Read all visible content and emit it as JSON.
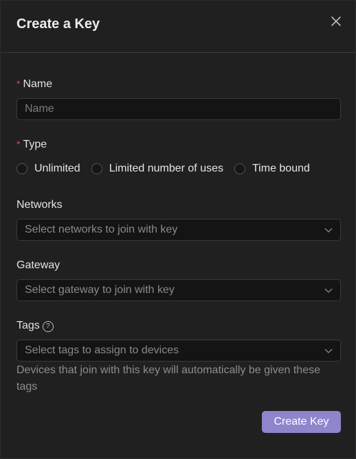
{
  "modal": {
    "title": "Create a Key"
  },
  "form": {
    "name": {
      "label": "Name",
      "required_mark": "*",
      "placeholder": "Name",
      "value": ""
    },
    "type": {
      "label": "Type",
      "required_mark": "*",
      "options": [
        {
          "label": "Unlimited",
          "selected": false
        },
        {
          "label": "Limited number of uses",
          "selected": false
        },
        {
          "label": "Time bound",
          "selected": false
        }
      ]
    },
    "networks": {
      "label": "Networks",
      "placeholder": "Select networks to join with key"
    },
    "gateway": {
      "label": "Gateway",
      "placeholder": "Select gateway to join with key"
    },
    "tags": {
      "label": "Tags",
      "help_icon": "question-circle-icon",
      "placeholder": "Select tags to assign to devices",
      "hint": "Devices that join with this key will automatically be given these tags"
    }
  },
  "actions": {
    "create_label": "Create Key"
  },
  "colors": {
    "accent": "#8e85cc",
    "required": "#e0434a",
    "background": "#202020"
  },
  "icons": {
    "close": "close-icon",
    "dropdown": "chevron-down-icon"
  }
}
